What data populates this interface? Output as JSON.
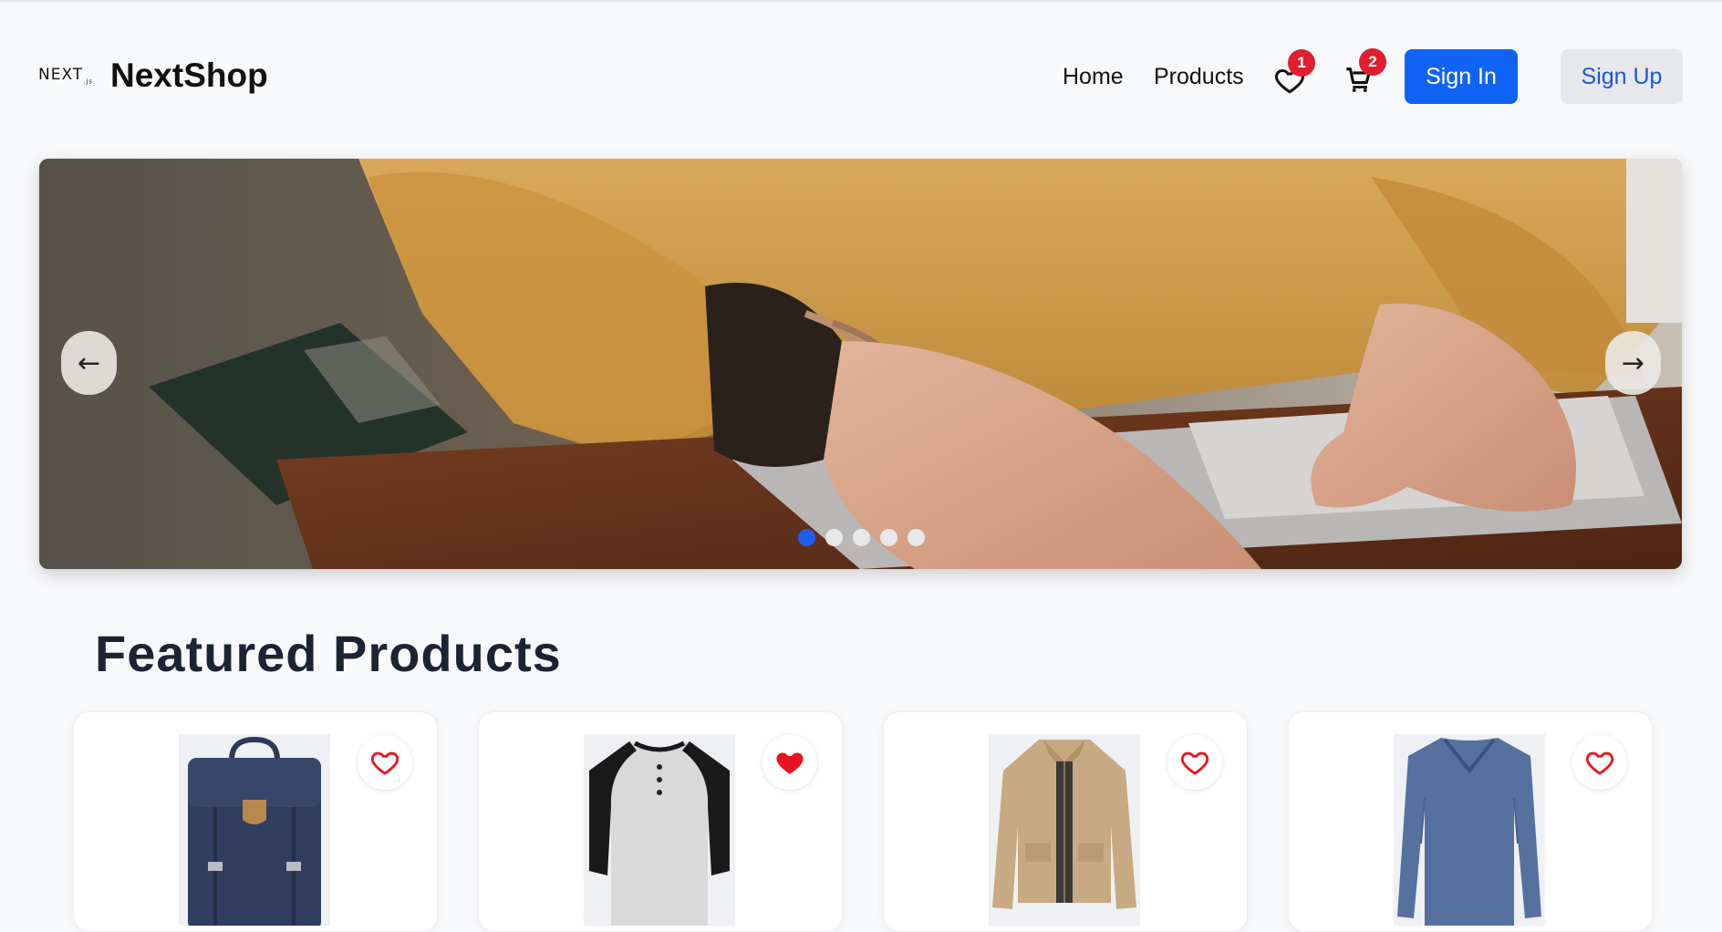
{
  "header": {
    "logo_text": "NEXT",
    "logo_suffix": ".js",
    "brand": "NextShop",
    "nav": [
      "Home",
      "Products"
    ],
    "wishlist_count": "1",
    "cart_count": "2",
    "sign_in": "Sign In",
    "sign_up": "Sign Up"
  },
  "hero": {
    "prev_glyph": "←",
    "next_glyph": "→",
    "slide_count": 5,
    "active_slide": 1
  },
  "featured": {
    "title": "Featured Products",
    "products": [
      {
        "image": "navy-backpack",
        "favorited": false
      },
      {
        "image": "raglan-henley-shirt",
        "favorited": true
      },
      {
        "image": "khaki-jacket",
        "favorited": false
      },
      {
        "image": "blue-vneck-longsleeve",
        "favorited": false
      }
    ]
  },
  "colors": {
    "primary": "#1163f5",
    "badge": "#e11d2e",
    "heart": "#e8141f",
    "title": "#1c2434"
  }
}
